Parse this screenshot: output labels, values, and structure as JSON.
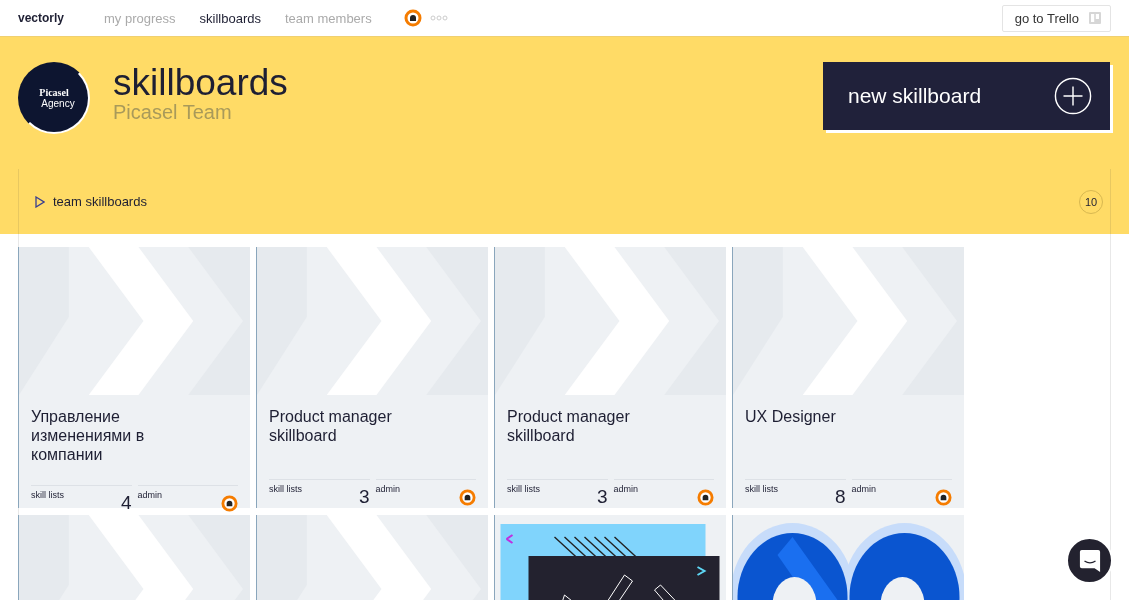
{
  "nav": {
    "logo": "vectorly",
    "tabs": [
      {
        "label": "my progress",
        "selected": false
      },
      {
        "label": "skillboards",
        "selected": true
      },
      {
        "label": "team members",
        "selected": false
      }
    ],
    "trello_button": "go to Trello"
  },
  "header": {
    "team_logo": [
      "Picasel",
      "Agency"
    ],
    "title": "skillboards",
    "subtitle": "Picasel Team",
    "new_button": "new skillboard"
  },
  "section": {
    "label": "team skillboards",
    "expanded": false,
    "count": "10"
  },
  "cards": [
    {
      "kind": "pattern",
      "title": "Управление изменениями в компании",
      "skill_lists_label": "skill lists",
      "skill_lists": "4",
      "admin_label": "admin"
    },
    {
      "kind": "pattern",
      "title": "Product manager skillboard",
      "skill_lists_label": "skill lists",
      "skill_lists": "3",
      "admin_label": "admin"
    },
    {
      "kind": "pattern",
      "title": "Product manager skillboard",
      "skill_lists_label": "skill lists",
      "skill_lists": "3",
      "admin_label": "admin"
    },
    {
      "kind": "pattern",
      "title": "UX Designer",
      "skill_lists_label": "skill lists",
      "skill_lists": "8",
      "admin_label": "admin"
    },
    {
      "kind": "pattern"
    },
    {
      "kind": "pattern"
    },
    {
      "kind": "picture"
    },
    {
      "kind": "picture"
    }
  ]
}
